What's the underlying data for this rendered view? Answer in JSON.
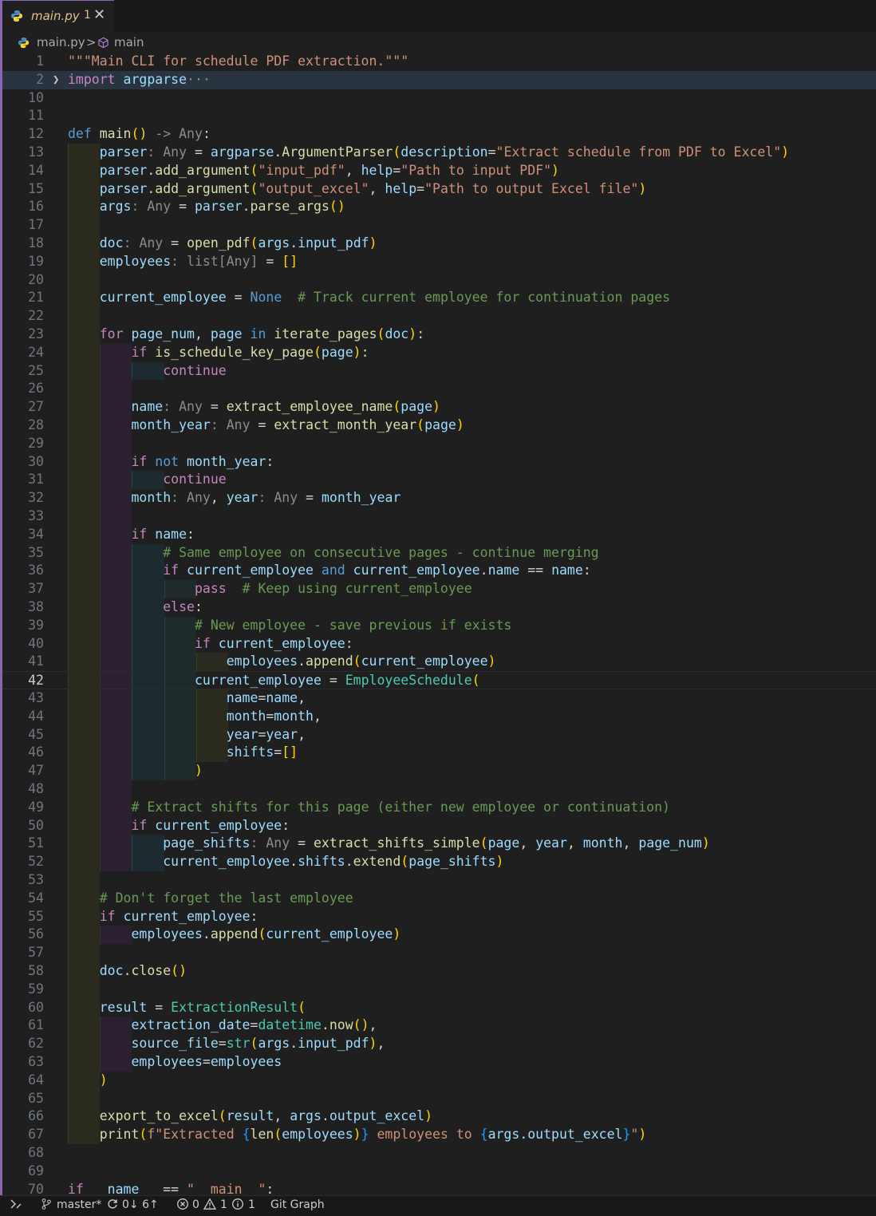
{
  "tab": {
    "filename": "main.py",
    "problem_count": "1"
  },
  "breadcrumb": {
    "file": "main.py",
    "separator": ">",
    "symbol": "main"
  },
  "status": {
    "branch": "master*",
    "sync": "0↓ 6↑",
    "errors": "0",
    "warnings": "1",
    "info": "1",
    "git_graph": "Git Graph"
  },
  "editor": {
    "active_line": "42",
    "lines": [
      {
        "n": "1",
        "t": "\"\"\"Main CLI for schedule PDF extraction.\"\"\""
      },
      {
        "n": "2",
        "t": "import argparse···"
      },
      {
        "n": "10",
        "t": ""
      },
      {
        "n": "11",
        "t": ""
      },
      {
        "n": "12",
        "t": "def main() -> Any:"
      },
      {
        "n": "13",
        "t": "    parser: Any = argparse.ArgumentParser(description=\"Extract schedule from PDF to Excel\")"
      },
      {
        "n": "14",
        "t": "    parser.add_argument(\"input_pdf\", help=\"Path to input PDF\")"
      },
      {
        "n": "15",
        "t": "    parser.add_argument(\"output_excel\", help=\"Path to output Excel file\")"
      },
      {
        "n": "16",
        "t": "    args: Any = parser.parse_args()"
      },
      {
        "n": "17",
        "t": ""
      },
      {
        "n": "18",
        "t": "    doc: Any = open_pdf(args.input_pdf)"
      },
      {
        "n": "19",
        "t": "    employees: list[Any] = []"
      },
      {
        "n": "20",
        "t": ""
      },
      {
        "n": "21",
        "t": "    current_employee = None  # Track current employee for continuation pages"
      },
      {
        "n": "22",
        "t": ""
      },
      {
        "n": "23",
        "t": "    for page_num, page in iterate_pages(doc):"
      },
      {
        "n": "24",
        "t": "        if is_schedule_key_page(page):"
      },
      {
        "n": "25",
        "t": "            continue"
      },
      {
        "n": "26",
        "t": ""
      },
      {
        "n": "27",
        "t": "        name: Any = extract_employee_name(page)"
      },
      {
        "n": "28",
        "t": "        month_year: Any = extract_month_year(page)"
      },
      {
        "n": "29",
        "t": ""
      },
      {
        "n": "30",
        "t": "        if not month_year:"
      },
      {
        "n": "31",
        "t": "            continue"
      },
      {
        "n": "32",
        "t": "        month: Any, year: Any = month_year"
      },
      {
        "n": "33",
        "t": ""
      },
      {
        "n": "34",
        "t": "        if name:"
      },
      {
        "n": "35",
        "t": "            # Same employee on consecutive pages - continue merging"
      },
      {
        "n": "36",
        "t": "            if current_employee and current_employee.name == name:"
      },
      {
        "n": "37",
        "t": "                pass  # Keep using current_employee"
      },
      {
        "n": "38",
        "t": "            else:"
      },
      {
        "n": "39",
        "t": "                # New employee - save previous if exists"
      },
      {
        "n": "40",
        "t": "                if current_employee:"
      },
      {
        "n": "41",
        "t": "                    employees.append(current_employee)"
      },
      {
        "n": "42",
        "t": "                current_employee = EmployeeSchedule("
      },
      {
        "n": "43",
        "t": "                    name=name,"
      },
      {
        "n": "44",
        "t": "                    month=month,"
      },
      {
        "n": "45",
        "t": "                    year=year,"
      },
      {
        "n": "46",
        "t": "                    shifts=[]"
      },
      {
        "n": "47",
        "t": "                )"
      },
      {
        "n": "48",
        "t": ""
      },
      {
        "n": "49",
        "t": "        # Extract shifts for this page (either new employee or continuation)"
      },
      {
        "n": "50",
        "t": "        if current_employee:"
      },
      {
        "n": "51",
        "t": "            page_shifts: Any = extract_shifts_simple(page, year, month, page_num)"
      },
      {
        "n": "52",
        "t": "            current_employee.shifts.extend(page_shifts)"
      },
      {
        "n": "53",
        "t": ""
      },
      {
        "n": "54",
        "t": "    # Don't forget the last employee"
      },
      {
        "n": "55",
        "t": "    if current_employee:"
      },
      {
        "n": "56",
        "t": "        employees.append(current_employee)"
      },
      {
        "n": "57",
        "t": ""
      },
      {
        "n": "58",
        "t": "    doc.close()"
      },
      {
        "n": "59",
        "t": ""
      },
      {
        "n": "60",
        "t": "    result = ExtractionResult("
      },
      {
        "n": "61",
        "t": "        extraction_date=datetime.now(),"
      },
      {
        "n": "62",
        "t": "        source_file=str(args.input_pdf),"
      },
      {
        "n": "63",
        "t": "        employees=employees"
      },
      {
        "n": "64",
        "t": "    )"
      },
      {
        "n": "65",
        "t": ""
      },
      {
        "n": "66",
        "t": "    export_to_excel(result, args.output_excel)"
      },
      {
        "n": "67",
        "t": "    print(f\"Extracted {len(employees)} employees to {args.output_excel}\")"
      },
      {
        "n": "68",
        "t": ""
      },
      {
        "n": "69",
        "t": ""
      },
      {
        "n": "70",
        "t": "if __name__ == \"__main__\":"
      }
    ]
  }
}
